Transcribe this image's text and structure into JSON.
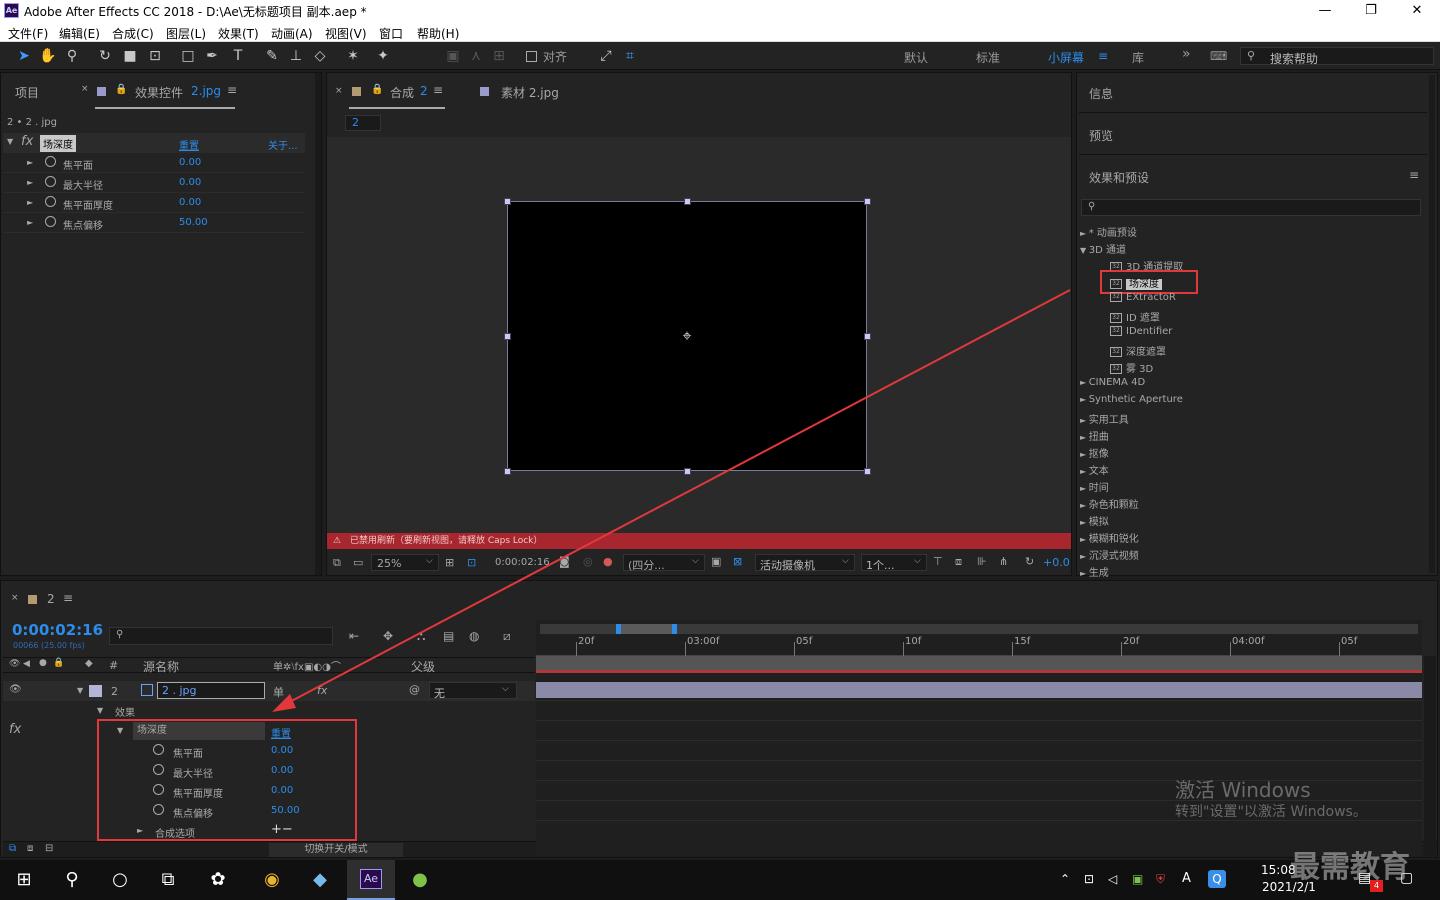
{
  "titlebar": {
    "app_icon": "Ae",
    "title": "Adobe After Effects CC 2018 - D:\\Ae\\无标题项目 副本.aep *",
    "minimize": "—",
    "maximize": "❐",
    "close": "✕"
  },
  "menu": [
    "文件(F)",
    "编辑(E)",
    "合成(C)",
    "图层(L)",
    "效果(T)",
    "动画(A)",
    "视图(V)",
    "窗口",
    "帮助(H)"
  ],
  "toolbar": {
    "snap_label": "对齐",
    "workspaces": [
      "默认",
      "标准",
      "小屏幕",
      "库"
    ],
    "active_workspace": "小屏幕",
    "search_placeholder": "搜索帮助"
  },
  "left_panel": {
    "tab_project": "项目",
    "tab_effects": "效果控件",
    "tab_effects_layer": "2.jpg",
    "layer_path": "2 • 2 . jpg",
    "effect": {
      "name": "场深度",
      "reset": "重置",
      "about": "关于..."
    },
    "params": [
      {
        "name": "焦平面",
        "value": "0.00"
      },
      {
        "name": "最大半径",
        "value": "0.00"
      },
      {
        "name": "焦平面厚度",
        "value": "0.00"
      },
      {
        "name": "焦点偏移",
        "value": "50.00"
      }
    ]
  },
  "comp_panel": {
    "tab_comp": "合成",
    "tab_comp_num": "2",
    "tab_footage": "素材 2.jpg",
    "comp_chip": "2",
    "warning": "已禁用刷新（要刷新视图，请释放 Caps Lock）",
    "zoom": "25%",
    "timecode": "0:00:02:16",
    "resolution": "(四分...",
    "camera": "活动摄像机",
    "views": "1个...",
    "exposure": "+0.0"
  },
  "right_panel": {
    "info": "信息",
    "preview": "预览",
    "effects_presets": "效果和预设",
    "tree": [
      {
        "label": "* 动画预设",
        "level": 0,
        "open": false
      },
      {
        "label": "3D 通道",
        "level": 0,
        "open": true
      },
      {
        "label": "3D 通道提取",
        "level": 1,
        "icon": true
      },
      {
        "label": "场深度",
        "level": 1,
        "icon": true,
        "selected": true
      },
      {
        "label": "EXtractoR",
        "level": 1,
        "icon": true
      },
      {
        "label": "ID 遮罩",
        "level": 1,
        "icon": true
      },
      {
        "label": "IDentifier",
        "level": 1,
        "icon": true
      },
      {
        "label": "深度遮罩",
        "level": 1,
        "icon": true
      },
      {
        "label": "雾 3D",
        "level": 1,
        "icon": true
      },
      {
        "label": "CINEMA 4D",
        "level": 0,
        "open": false
      },
      {
        "label": "Synthetic Aperture",
        "level": 0,
        "open": false
      },
      {
        "label": "实用工具",
        "level": 0,
        "open": false
      },
      {
        "label": "扭曲",
        "level": 0,
        "open": false
      },
      {
        "label": "抠像",
        "level": 0,
        "open": false
      },
      {
        "label": "文本",
        "level": 0,
        "open": false
      },
      {
        "label": "时间",
        "level": 0,
        "open": false
      },
      {
        "label": "杂色和颗粒",
        "level": 0,
        "open": false
      },
      {
        "label": "模拟",
        "level": 0,
        "open": false
      },
      {
        "label": "模糊和锐化",
        "level": 0,
        "open": false
      },
      {
        "label": "沉浸式视频",
        "level": 0,
        "open": false
      },
      {
        "label": "生成",
        "level": 0,
        "open": false
      }
    ]
  },
  "timeline": {
    "tab": "2",
    "timecode": "0:00:02:16",
    "frames": "00066 (25.00 fps)",
    "col_source": "源名称",
    "col_parent": "父级",
    "col_num": "#",
    "layer": {
      "num": "2",
      "name": "2 . jpg",
      "parent": "无"
    },
    "effects_label": "效果",
    "effect": {
      "name": "场深度",
      "reset": "重置"
    },
    "params": [
      {
        "name": "焦平面",
        "value": "0.00"
      },
      {
        "name": "最大半径",
        "value": "0.00"
      },
      {
        "name": "焦平面厚度",
        "value": "0.00"
      },
      {
        "name": "焦点偏移",
        "value": "50.00"
      }
    ],
    "composite": "合成选项",
    "composite_ctrl": "+−",
    "switches": "切换开关/模式",
    "ruler": [
      "20f",
      "03:00f",
      "05f",
      "10f",
      "15f",
      "20f",
      "04:00f",
      "05f"
    ]
  },
  "watermark": {
    "line1": "激活 Windows",
    "line2": "转到\"设置\"以激活 Windows。",
    "brand": "最需教育"
  },
  "taskbar": {
    "time": "15:08",
    "date": "2021/2/1",
    "badge": "4",
    "ime": "A"
  },
  "colors": {
    "accent": "#2d8ceb",
    "highlight_box": "#e0383b",
    "warning_bar": "#a8262e",
    "layer_bar": "#8a8aa8"
  }
}
